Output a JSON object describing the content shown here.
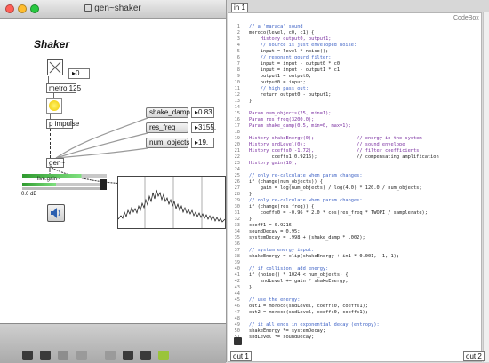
{
  "window": {
    "title": "gen~shaker",
    "traffic_colors": [
      "#ff5f57",
      "#ffbd2e",
      "#28c840"
    ]
  },
  "patcher": {
    "heading": "Shaker",
    "toggle_value": "0",
    "metro_label": "metro 125",
    "impulse_label": "p impulse",
    "gen_label": "gen~",
    "meter_label": "live.gain~",
    "meter_value": "0.0 dB",
    "params": [
      {
        "name": "shake_damp",
        "value": "0.83"
      },
      {
        "name": "res_freq",
        "value": "3155."
      },
      {
        "name": "num_objects",
        "value": "19."
      }
    ],
    "toolbar_icons": [
      "lock-icon",
      "presentation-icon",
      "grid-icon",
      "new-object-icon",
      "info-icon",
      "inspector-icon",
      "console-icon",
      "wheel-icon"
    ]
  },
  "codebox": {
    "inlet": "in 1",
    "label": "CodeBox",
    "outlets": [
      "out 1",
      "out 2"
    ],
    "lines": [
      "// a 'maraca' sound",
      "moroco(level, c0, c1) {",
      "    History output0, output1;",
      "    // source is just enveloped noise:",
      "    input = level * noise();",
      "    // resonant gourd filter:",
      "    input = input - output0 * c0;",
      "    input = input - output1 * c1;",
      "    output1 = output0;",
      "    output0 = input;",
      "    // high pass out:",
      "    return output0 - output1;",
      "}",
      "",
      "Param num_objects(25, min=1);",
      "Param res_freq(3200.0);",
      "Param shake_damp(0.5, min=0, max=1);",
      "",
      "History shakeEnergy(0);               // energy in the system",
      "History sndLevel(0);                  // sound envelope",
      "History coeffs0(-1.72),               // filter coefficients",
      "        coeffs1(0.9216);              // compensating amplification",
      "History gain(10);",
      "",
      "// only re-calculate when param changes:",
      "if (change(num_objects)) {",
      "    gain = log(num_objects) / log(4.0) * 120.0 / num_objects;",
      "}",
      "// only re-calculate when param changes:",
      "if (change(res_freq)) {",
      "    coeffs0 = -0.96 * 2.0 * cos(res_freq * TWOPI / samplerate);",
      "}",
      "coeff1 = 0.9216;",
      "soundDecay = 0.95;",
      "systemDecay = .998 + (shake_damp * .002);",
      "",
      "// system energy input:",
      "shakeEnergy = clip(shakeEnergy + in1 * 0.001, -1, 1);",
      "",
      "// if collision, add energy:",
      "if (noise() * 1024 < num_objects) {",
      "    sndLevel += gain * shakeEnergy;",
      "}",
      "",
      "// use the energy:",
      "out1 = moroco(sndLevel, coeffs0, coeffs1);",
      "out2 = moroco(sndLevel, coeffs0, coeffs1);",
      "",
      "// it all ends in exponential decay (entropy):",
      "shakeEnergy *= systemDecay;",
      "sndLevel *= soundDecay;"
    ]
  }
}
